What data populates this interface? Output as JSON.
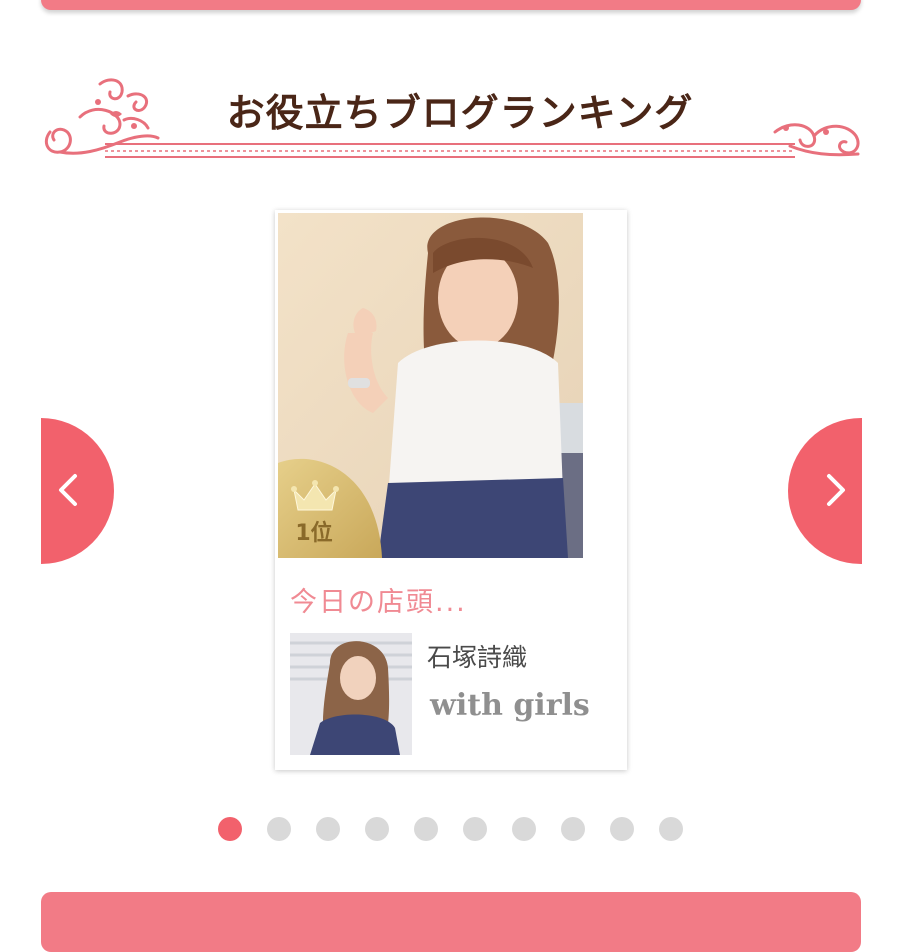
{
  "section": {
    "title": "お役立ちブログランキング"
  },
  "card": {
    "rank_label": "1位",
    "post_title": "今日の店頭...",
    "author_name": "石塚詩織",
    "blog_name": "with girls"
  },
  "pagination": {
    "count": 10,
    "active_index": 0
  },
  "icons": {
    "prev": "chevron-left-icon",
    "next": "chevron-right-icon",
    "rank": "crown-icon"
  },
  "colors": {
    "accent": "#f2616c",
    "bar": "#f27b86",
    "heading": "#4a2617",
    "post_title": "#f08a93",
    "dot_inactive": "#d9d9d9"
  }
}
